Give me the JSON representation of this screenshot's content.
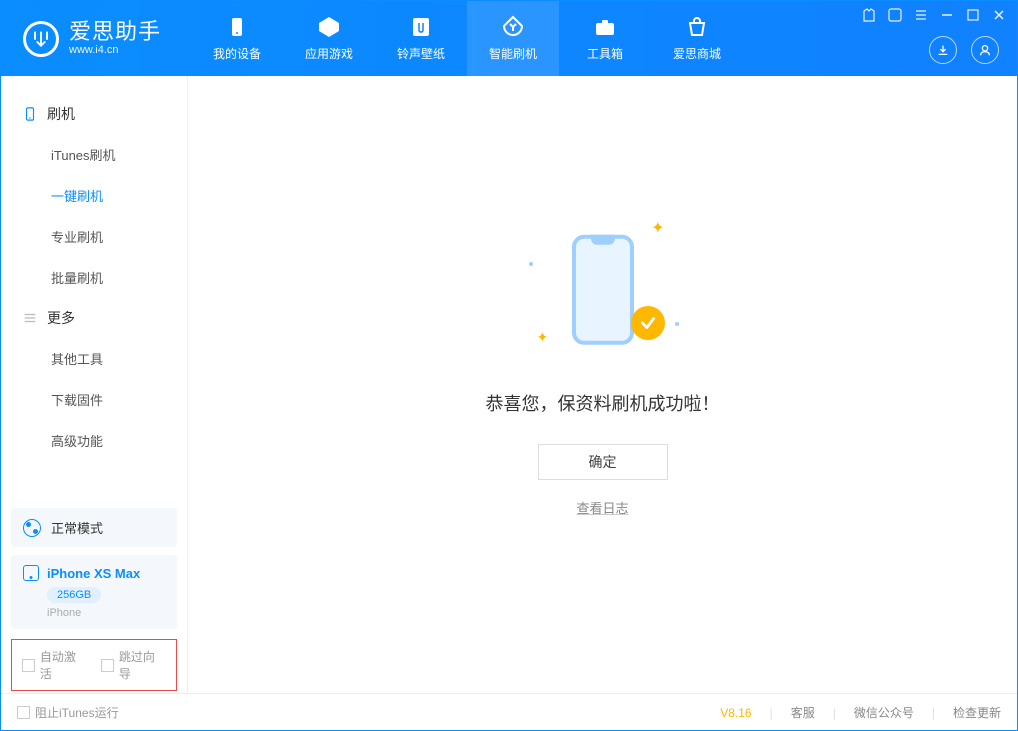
{
  "app": {
    "title": "爱思助手",
    "subtitle": "www.i4.cn"
  },
  "tabs": {
    "device": "我的设备",
    "apps": "应用游戏",
    "ringtone": "铃声壁纸",
    "flash": "智能刷机",
    "toolbox": "工具箱",
    "store": "爱思商城",
    "active": "flash"
  },
  "sidebar": {
    "cat_flash": "刷机",
    "items_flash": [
      "iTunes刷机",
      "一键刷机",
      "专业刷机",
      "批量刷机"
    ],
    "active_flash_index": 1,
    "cat_more": "更多",
    "items_more": [
      "其他工具",
      "下载固件",
      "高级功能"
    ]
  },
  "mode": {
    "label": "正常模式"
  },
  "device": {
    "name": "iPhone XS Max",
    "capacity": "256GB",
    "type": "iPhone"
  },
  "options": {
    "auto_activate": "自动激活",
    "skip_guide": "跳过向导"
  },
  "main": {
    "success_text": "恭喜您，保资料刷机成功啦！",
    "ok": "确定",
    "view_log": "查看日志"
  },
  "footer": {
    "block_itunes": "阻止iTunes运行",
    "version": "V8.16",
    "support": "客服",
    "wechat": "微信公众号",
    "check_update": "检查更新"
  }
}
